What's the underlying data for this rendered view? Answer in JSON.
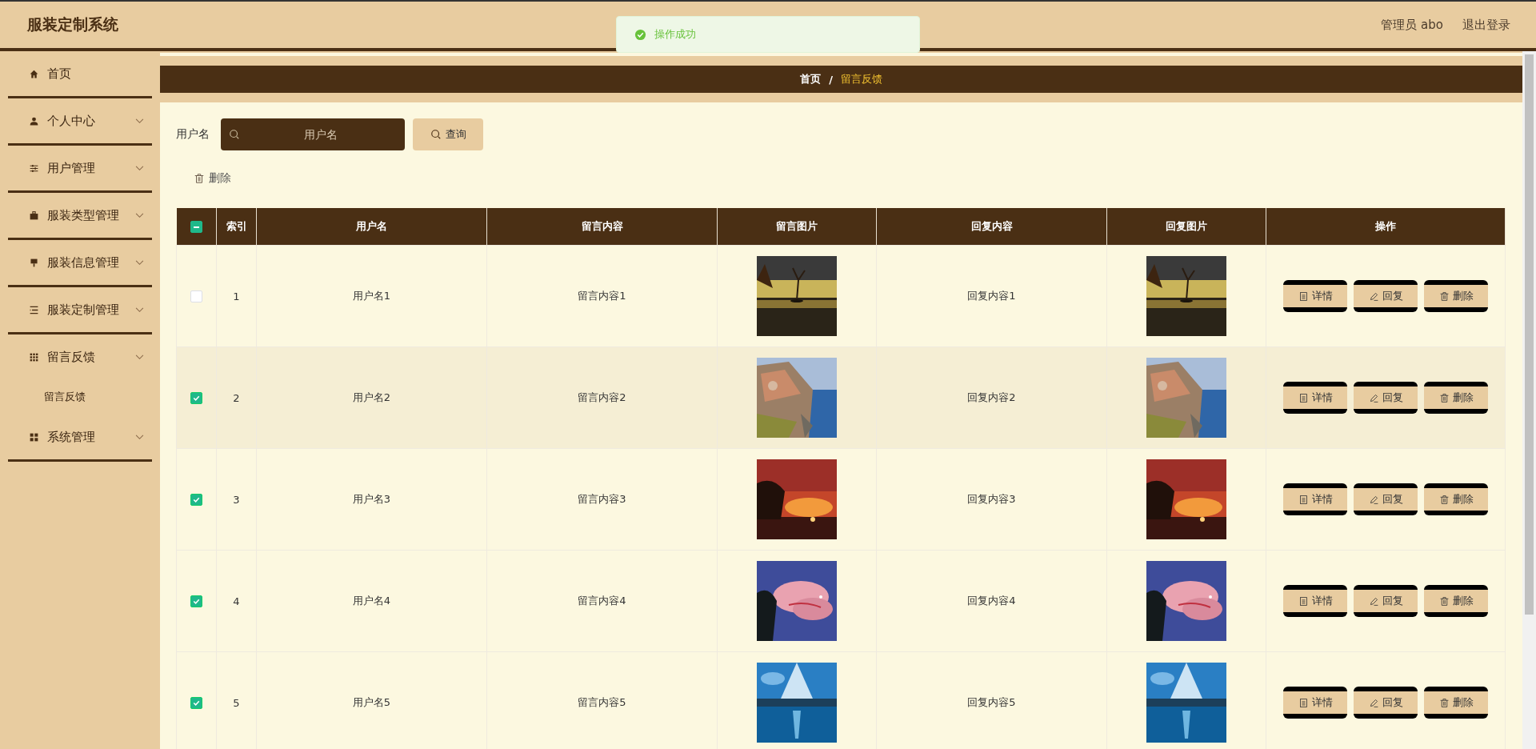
{
  "header": {
    "title": "服装定制系统",
    "user": "管理员 abo",
    "logout": "退出登录"
  },
  "toast": {
    "message": "操作成功"
  },
  "sidebar": {
    "items": [
      {
        "label": "首页",
        "kind": "link"
      },
      {
        "label": "个人中心",
        "kind": "menu"
      },
      {
        "label": "用户管理",
        "kind": "menu"
      },
      {
        "label": "服装类型管理",
        "kind": "menu"
      },
      {
        "label": "服装信息管理",
        "kind": "menu"
      },
      {
        "label": "服装定制管理",
        "kind": "menu"
      },
      {
        "label": "留言反馈",
        "kind": "menu",
        "expanded": true,
        "children": [
          {
            "label": "留言反馈"
          }
        ]
      },
      {
        "label": "系统管理",
        "kind": "menu"
      }
    ]
  },
  "breadcrumb": [
    {
      "label": "首页",
      "selected": false
    },
    {
      "label": "/",
      "selected": false
    },
    {
      "label": "留言反馈",
      "selected": true
    }
  ],
  "search": {
    "label": "用户名",
    "placeholder": "用户名",
    "button": "查询"
  },
  "toolbar": {
    "delete": "删除"
  },
  "table": {
    "header_indeterminate": true,
    "columns": [
      "索引",
      "用户名",
      "留言内容",
      "留言图片",
      "回复内容",
      "回复图片",
      "操作"
    ],
    "rows": [
      {
        "index": "1",
        "user": "用户名1",
        "content": "留言内容1",
        "reply": "回复内容1",
        "selected": false,
        "hovered": false,
        "actions": [
          "详情",
          "回复",
          "删除"
        ]
      },
      {
        "index": "2",
        "user": "用户名2",
        "content": "留言内容2",
        "reply": "回复内容2",
        "selected": true,
        "hovered": true,
        "actions": [
          "详情",
          "回复",
          "删除"
        ]
      },
      {
        "index": "3",
        "user": "用户名3",
        "content": "留言内容3",
        "reply": "回复内容3",
        "selected": true,
        "hovered": false,
        "actions": [
          "详情",
          "回复",
          "删除"
        ]
      },
      {
        "index": "4",
        "user": "用户名4",
        "content": "留言内容4",
        "reply": "回复内容4",
        "selected": true,
        "hovered": false,
        "actions": [
          "详情",
          "回复",
          "删除"
        ]
      },
      {
        "index": "5",
        "user": "用户名5",
        "content": "留言内容5",
        "reply": "回复内容5",
        "selected": true,
        "hovered": false,
        "actions": [
          "详情",
          "回复",
          "删除"
        ]
      }
    ]
  }
}
